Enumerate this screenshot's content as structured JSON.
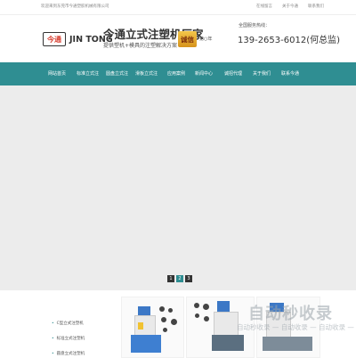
{
  "topbar": {
    "welcome": "欢迎来到东莞市今通塑胶机械有限公司",
    "links": [
      "在线留言",
      "关于今通",
      "联系我们"
    ]
  },
  "header": {
    "logo_mark": "今通",
    "logo_text": "JIN TONG",
    "slogan_title": "今通立式注塑机厂家",
    "slogan_sub": "提供塑机+模具的注塑解决方案",
    "badge": "诚信",
    "badge_note": "第○年",
    "hotline_label": "全国服务热线：",
    "hotline_number": "139-2653-6012(何总监)"
  },
  "nav": {
    "items": [
      "网站首页",
      "标准立式注",
      "圆盘立式注",
      "滑板立式注",
      "应用案例",
      "新闻中心",
      "诚招代理",
      "关于我们",
      "联系今通"
    ]
  },
  "pager": [
    "1",
    "2",
    "3"
  ],
  "sidebar": {
    "title": "产品中心",
    "items": [
      "C型立式注塑机",
      "标准立式注塑机",
      "圆盘立式注塑机"
    ]
  },
  "watermark": {
    "main": "自动秒收录",
    "sub": "自动秒收录 — 自动收录 — 自动收录 —"
  },
  "colors": {
    "accent": "#2f8e92",
    "hero": "#ececec"
  }
}
